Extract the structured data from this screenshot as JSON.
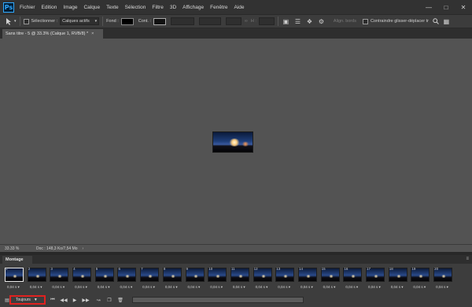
{
  "menubar": {
    "logo": "Ps",
    "items": [
      "Fichier",
      "Edition",
      "Image",
      "Calque",
      "Texte",
      "Sélection",
      "Filtre",
      "3D",
      "Affichage",
      "Fenêtre",
      "Aide"
    ]
  },
  "options": {
    "select_label": "Sélectionner :",
    "select_value": "Calques actifs",
    "fill_label": "Fond :",
    "contour_label": "Cont. :",
    "h_label": "H :",
    "align_label": "Align. bords",
    "constrain_label": "Contraindre glisser-déplacer tr"
  },
  "document_tab": {
    "title": "Sans titre - 5 @ 33.3% (Calque 1, RVB/8) *",
    "close": "×"
  },
  "status": {
    "zoom": "33.33 %",
    "doc": "Doc : 148,3 Ko/7,54 Mo",
    "arrow": "›"
  },
  "timeline": {
    "tab_label": "Montage",
    "menu_icon": "≡",
    "loop_label": "Toujours",
    "frames": [
      {
        "num": "1",
        "delay": "0,04 s"
      },
      {
        "num": "2",
        "delay": "0,04 s"
      },
      {
        "num": "3",
        "delay": "0,04 s"
      },
      {
        "num": "4",
        "delay": "0,04 s"
      },
      {
        "num": "5",
        "delay": "0,04 s"
      },
      {
        "num": "6",
        "delay": "0,04 s"
      },
      {
        "num": "7",
        "delay": "0,04 s"
      },
      {
        "num": "8",
        "delay": "0,04 s"
      },
      {
        "num": "9",
        "delay": "0,04 s"
      },
      {
        "num": "10",
        "delay": "0,04 s"
      },
      {
        "num": "11",
        "delay": "0,04 s"
      },
      {
        "num": "12",
        "delay": "0,04 s"
      },
      {
        "num": "13",
        "delay": "0,04 s"
      },
      {
        "num": "14",
        "delay": "0,04 s"
      },
      {
        "num": "15",
        "delay": "0,04 s"
      },
      {
        "num": "16",
        "delay": "0,04 s"
      },
      {
        "num": "17",
        "delay": "0,04 s"
      },
      {
        "num": "18",
        "delay": "0,04 s"
      },
      {
        "num": "19",
        "delay": "0,04 s"
      },
      {
        "num": "20",
        "delay": "0,04 s"
      }
    ]
  }
}
